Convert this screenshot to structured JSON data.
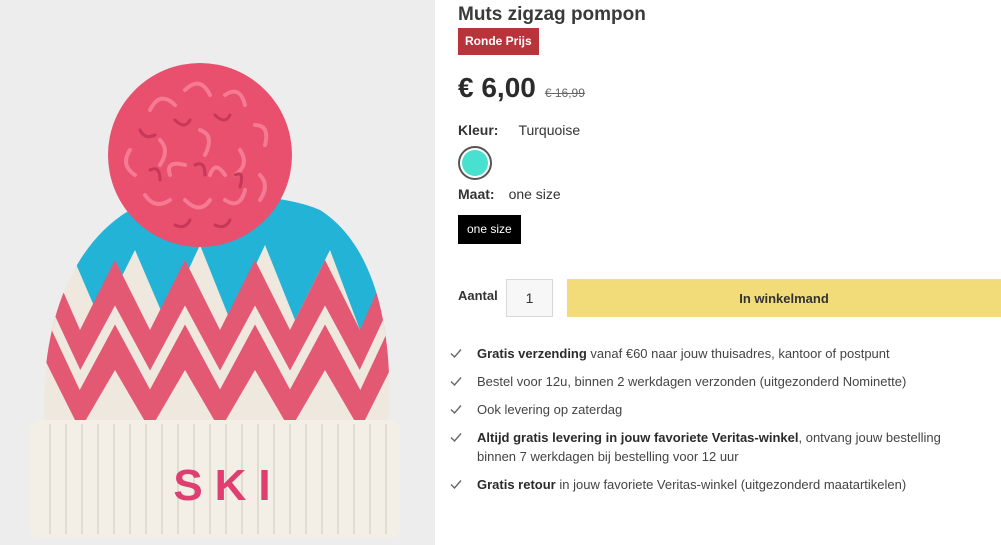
{
  "product": {
    "title": "Muts zigzag pompon",
    "badge": "Ronde Prijs",
    "price": "€ 6,00",
    "old_price": "€ 16,99",
    "image_alt": "SKI",
    "image_icon": "knit-hat-image"
  },
  "color": {
    "label": "Kleur:",
    "value": "Turquoise",
    "swatch_hex": "#48e0cf"
  },
  "size": {
    "label": "Maat:",
    "value": "one size",
    "option": "one size"
  },
  "cart": {
    "qty_label": "Aantal",
    "qty_value": "1",
    "button_label": "In winkelmand",
    "button_color": "#f1dc79"
  },
  "usps": [
    {
      "bold": "Gratis verzending",
      "text": " vanaf €60 naar jouw thuisadres, kantoor of postpunt"
    },
    {
      "bold": "",
      "text": "Bestel voor 12u, binnen 2 werkdagen verzonden (uitgezonderd Nominette)"
    },
    {
      "bold": "",
      "text": "Ook levering op zaterdag"
    },
    {
      "bold": "Altijd gratis levering in jouw favoriete Veritas-winkel",
      "text": ", ontvang jouw bestelling binnen 7 werkdagen bij bestelling voor 12 uur"
    },
    {
      "bold": "Gratis retour",
      "text": " in jouw favoriete Veritas-winkel (uitgezonderd maatartikelen)"
    }
  ],
  "icons": {
    "usp": "check-icon"
  }
}
